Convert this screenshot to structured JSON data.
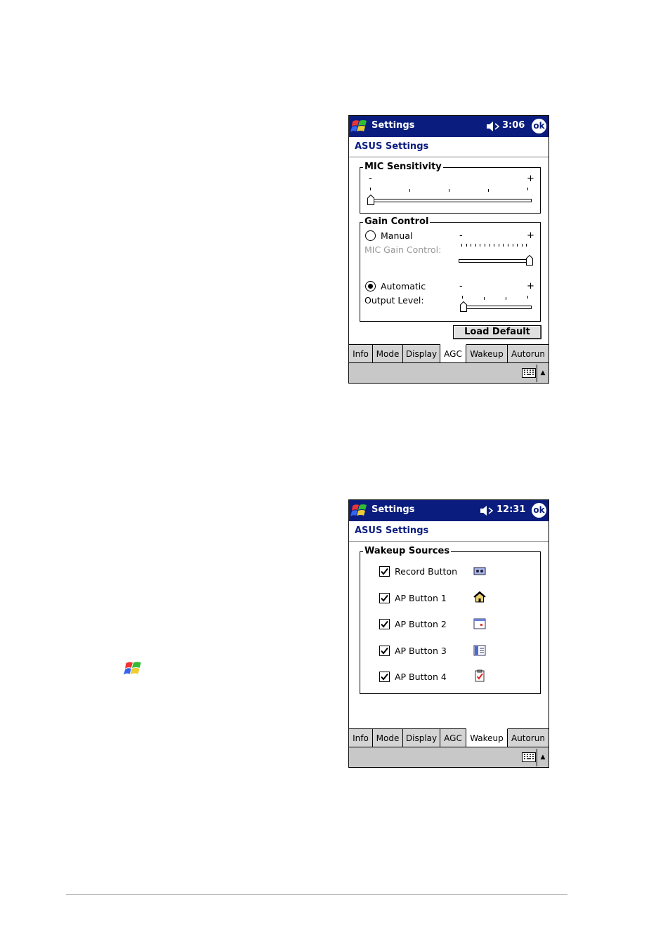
{
  "screen1": {
    "title": "Settings",
    "clock": "3:06",
    "ok_label": "ok",
    "header": "ASUS Settings",
    "mic": {
      "group_title": "MIC Sensitivity",
      "minus": "-",
      "plus": "+",
      "level": 0.0
    },
    "gain": {
      "group_title": "Gain Control",
      "manual_label": "Manual",
      "manual_selected": false,
      "mic_gain_label": "MIC Gain Control:",
      "mic_gain_level": 1.0,
      "automatic_label": "Automatic",
      "automatic_selected": true,
      "output_label": "Output Level:",
      "output_level": 0.0,
      "minus": "-",
      "plus": "+"
    },
    "load_default_label": "Load Default",
    "tabs": [
      "Info",
      "Mode",
      "Display",
      "AGC",
      "Wakeup",
      "Autorun"
    ],
    "active_tab": "AGC"
  },
  "screen2": {
    "title": "Settings",
    "clock": "12:31",
    "ok_label": "ok",
    "header": "ASUS Settings",
    "wakeup": {
      "group_title": "Wakeup Sources",
      "items": [
        {
          "label": "Record Button",
          "checked": true,
          "icon": "recorder-icon"
        },
        {
          "label": "AP Button 1",
          "checked": true,
          "icon": "home-icon"
        },
        {
          "label": "AP Button 2",
          "checked": true,
          "icon": "calendar-icon"
        },
        {
          "label": "AP Button 3",
          "checked": true,
          "icon": "contacts-icon"
        },
        {
          "label": "AP Button 4",
          "checked": true,
          "icon": "tasks-icon"
        }
      ]
    },
    "tabs": [
      "Info",
      "Mode",
      "Display",
      "AGC",
      "Wakeup",
      "Autorun"
    ],
    "active_tab": "Wakeup"
  },
  "colors": {
    "titlebar": "#0a1d7e",
    "header_text": "#0a1d7e",
    "tabbar": "#d4d4d4",
    "disabled_text": "#999999"
  }
}
